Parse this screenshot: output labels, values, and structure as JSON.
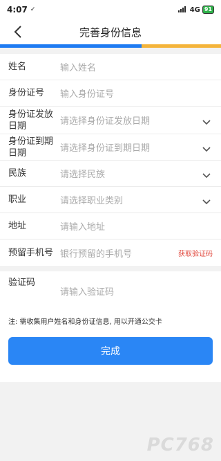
{
  "status": {
    "time": "4:07",
    "time_suffix": "✓",
    "network": "4G",
    "battery": "91"
  },
  "header": {
    "title": "完善身份信息",
    "back_icon": "chevron-left-icon"
  },
  "colors": {
    "accent_blue": "#1e7bf2",
    "accent_yellow": "#f4b43a",
    "button": "#2a86f5",
    "link_red": "#e0453a"
  },
  "form": {
    "name": {
      "label": "姓名",
      "placeholder": "输入姓名"
    },
    "id_number": {
      "label": "身份证号",
      "placeholder": "输入身份证号"
    },
    "issue_date": {
      "label": "身份证发放日期",
      "placeholder": "请选择身份证发放日期"
    },
    "expiry_date": {
      "label": "身份证到期日期",
      "placeholder": "请选择身份证到期日期"
    },
    "ethnicity": {
      "label": "民族",
      "placeholder": "请选择民族"
    },
    "occupation": {
      "label": "职业",
      "placeholder": "请选择职业类别"
    },
    "address": {
      "label": "地址",
      "placeholder": "请输入地址"
    },
    "phone": {
      "label": "预留手机号",
      "placeholder": "银行预留的手机号",
      "action": "获取验证码"
    },
    "code": {
      "label": "验证码",
      "placeholder": "请输入验证码"
    }
  },
  "note": "注: 需收集用户姓名和身份证信息, 用以开通公交卡",
  "submit_label": "完成",
  "watermark": "PC768"
}
